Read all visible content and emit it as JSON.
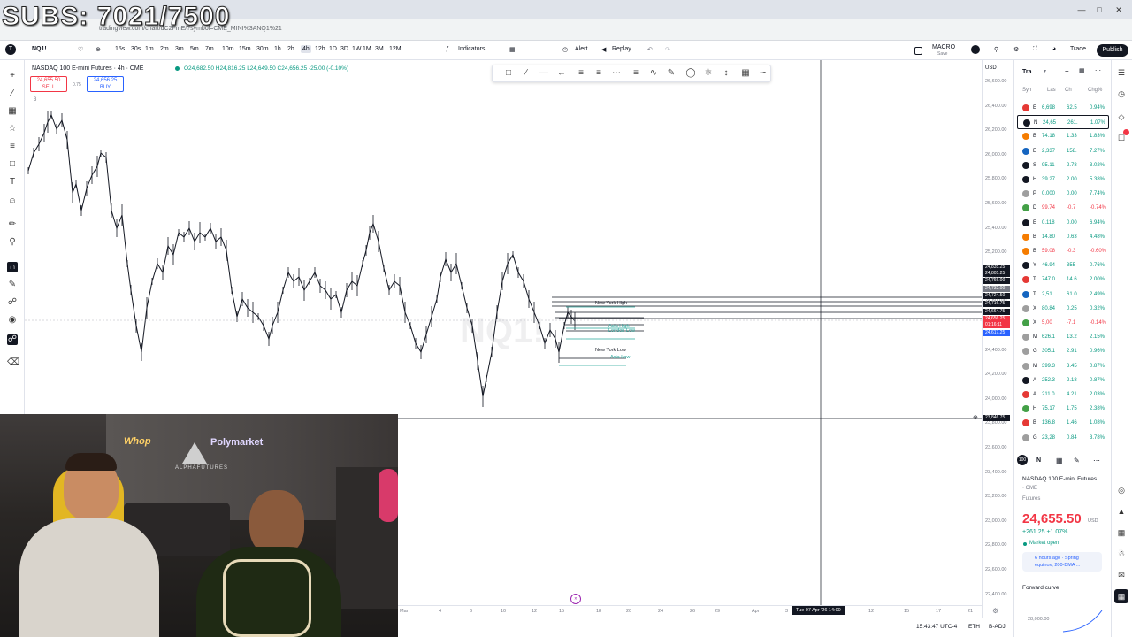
{
  "overlay": {
    "subs_text": "SUBS: 7021/7500"
  },
  "browser": {
    "url": "tradingview.com/chart/dC2FmE/?symbol=CME_MINI%3ANQ1%21"
  },
  "toolbar": {
    "symbol": "NQ1!",
    "intervals": [
      "15s",
      "30s",
      "1m",
      "2m",
      "3m",
      "5m",
      "7m",
      "10m",
      "15m",
      "30m",
      "1h",
      "2h",
      "4h",
      "12h",
      "1D",
      "3D",
      "1W",
      "1M",
      "3M",
      "12M"
    ],
    "selected_interval": "4h",
    "indicators_label": "Indicators",
    "alert_label": "Alert",
    "replay_label": "Replay",
    "macro_label": "MACRO",
    "macro_sub": "Save",
    "trade_label": "Trade",
    "publish_label": "Publish"
  },
  "chart": {
    "title": "NASDAQ 100 E-mini Futures · 4h · CME",
    "ohlc": "O24,682.50 H24,816.25 L24,649.50 C24,656.25 -25.00 (-0.10%)",
    "sell_price": "24,655.50",
    "sell_label": "SELL",
    "buy_price": "24,656.25",
    "buy_label": "BUY",
    "spread": "0.75",
    "layer_count": "3",
    "watermark": "NQ1!",
    "currency": "USD",
    "annotations": [
      "New York High",
      "Asia High",
      "London Low",
      "New York Low",
      "Asia Low"
    ],
    "price_ticks": [
      "26,600.00",
      "26,400.00",
      "26,200.00",
      "26,000.00",
      "25,800.00",
      "25,600.00",
      "25,400.00",
      "25,200.00",
      "25,000.00",
      "24,800.00",
      "24,600.00",
      "24,400.00",
      "24,200.00",
      "24,000.00",
      "23,800.00",
      "23,600.00",
      "23,400.00",
      "23,200.00",
      "23,000.00",
      "22,800.00",
      "22,600.00",
      "22,400.00"
    ],
    "price_labels": [
      {
        "text": "24,835.25",
        "color": "#131722"
      },
      {
        "text": "24,805.25",
        "color": "#131722"
      },
      {
        "text": "24,766.00",
        "color": "#131722"
      },
      {
        "text": "24,732.00",
        "color": "#787b86"
      },
      {
        "text": "24,724.50",
        "color": "#131722"
      },
      {
        "text": "24,716.75",
        "color": "#131722"
      },
      {
        "text": "24,664.75",
        "color": "#131722"
      },
      {
        "text": "24,656.25",
        "color": "#f23645"
      },
      {
        "text": "01:16:11",
        "color": "#f23645"
      },
      {
        "text": "24,617.25",
        "color": "#2962ff"
      }
    ],
    "crosshair_price": "23,846.75",
    "time_ticks": [
      "Mar",
      "4",
      "6",
      "10",
      "12",
      "15",
      "18",
      "20",
      "24",
      "26",
      "29",
      "Apr",
      "3",
      "12",
      "15",
      "17",
      "21"
    ],
    "crosshair_time": "Tue 07 Apr '26  14:00"
  },
  "status": {
    "time": "15:43:47 UTC-4",
    "session": "ETH",
    "adj": "B-ADJ"
  },
  "watchlist": {
    "header": "Tra",
    "columns": [
      "Syn",
      "Las",
      "Ch",
      "Chg%"
    ],
    "rows": [
      {
        "sym": "E",
        "last": "6,698",
        "chg": "62.5",
        "pct": "0.94%",
        "dir": "up",
        "color": "#e53935"
      },
      {
        "sym": "N",
        "last": "24,65",
        "chg": "261.",
        "pct": "1.07%",
        "dir": "up",
        "color": "#131722"
      },
      {
        "sym": "B",
        "last": "74.18",
        "chg": "1.33",
        "pct": "1.83%",
        "dir": "up",
        "color": "#f57c00"
      },
      {
        "sym": "E",
        "last": "2,337",
        "chg": "158.",
        "pct": "7.27%",
        "dir": "up",
        "color": "#1565c0"
      },
      {
        "sym": "S",
        "last": "95.11",
        "chg": "2.78",
        "pct": "3.02%",
        "dir": "up",
        "color": "#131722"
      },
      {
        "sym": "H",
        "last": "39.27",
        "chg": "2.00",
        "pct": "5.38%",
        "dir": "up",
        "color": "#131722"
      },
      {
        "sym": "P",
        "last": "0.000",
        "chg": "0.00",
        "pct": "7.74%",
        "dir": "up",
        "color": "#9e9e9e"
      },
      {
        "sym": "D",
        "last": "99.74",
        "chg": "-0.7",
        "pct": "-0.74%",
        "dir": "dn",
        "color": "#43a047"
      },
      {
        "sym": "E",
        "last": "0.118",
        "chg": "0.00",
        "pct": "6.94%",
        "dir": "up",
        "color": "#131722"
      },
      {
        "sym": "B",
        "last": "14.80",
        "chg": "0.63",
        "pct": "4.48%",
        "dir": "up",
        "color": "#f57c00"
      },
      {
        "sym": "B",
        "last": "59.08",
        "chg": "-0.3",
        "pct": "-0.60%",
        "dir": "dn",
        "color": "#f57c00"
      },
      {
        "sym": "Y",
        "last": "46.94",
        "chg": "355",
        "pct": "0.76%",
        "dir": "up",
        "color": "#131722"
      },
      {
        "sym": "T",
        "last": "747.0",
        "chg": "14.6",
        "pct": "2.00%",
        "dir": "up",
        "color": "#e53935"
      },
      {
        "sym": "T",
        "last": "2,51",
        "chg": "61.0",
        "pct": "2.49%",
        "dir": "up",
        "color": "#1565c0"
      },
      {
        "sym": "X",
        "last": "80.84",
        "chg": "0.25",
        "pct": "0.32%",
        "dir": "up",
        "color": "#9e9e9e"
      },
      {
        "sym": "X",
        "last": "5,00",
        "chg": "-7.1",
        "pct": "-0.14%",
        "dir": "dn",
        "color": "#43a047"
      },
      {
        "sym": "M",
        "last": "626.1",
        "chg": "13.2",
        "pct": "2.15%",
        "dir": "up",
        "color": "#9e9e9e"
      },
      {
        "sym": "G",
        "last": "305.1",
        "chg": "2.91",
        "pct": "0.96%",
        "dir": "up",
        "color": "#9e9e9e"
      },
      {
        "sym": "M",
        "last": "399.3",
        "chg": "3.45",
        "pct": "0.87%",
        "dir": "up",
        "color": "#9e9e9e"
      },
      {
        "sym": "A",
        "last": "252.3",
        "chg": "2.18",
        "pct": "0.87%",
        "dir": "up",
        "color": "#131722"
      },
      {
        "sym": "A",
        "last": "211.0",
        "chg": "4.21",
        "pct": "2.03%",
        "dir": "up",
        "color": "#e53935"
      },
      {
        "sym": "H",
        "last": "75.17",
        "chg": "1.75",
        "pct": "2.38%",
        "dir": "up",
        "color": "#43a047"
      },
      {
        "sym": "B",
        "last": "136.8",
        "chg": "1.46",
        "pct": "1.08%",
        "dir": "up",
        "color": "#e53935"
      },
      {
        "sym": "G",
        "last": "23,28",
        "chg": "0.84",
        "pct": "3.78%",
        "dir": "up",
        "color": "#9e9e9e"
      }
    ]
  },
  "details": {
    "sym": "N",
    "name": "NASDAQ 100 E-mini Futures",
    "exchange": "· CME",
    "category": "Futures",
    "price": "24,655.50",
    "currency": "USD",
    "change": "+261.25 +1.07%",
    "market_status": "Market open",
    "news": "6 hours ago · Spring equinox, 200-DMA ...",
    "forward_curve": "Forward curve",
    "curve_price": "28,000.00"
  },
  "webcam": {
    "sponsor_1": "Whop",
    "sponsor_2": "Polymarket",
    "sponsor_3": "ALPHAFUTURES"
  }
}
